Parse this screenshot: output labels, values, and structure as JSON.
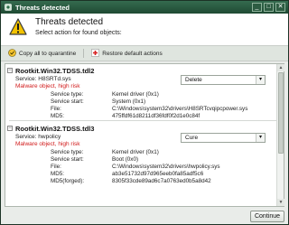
{
  "window": {
    "title": "Threats detected",
    "controls": [
      "_",
      "□",
      "✕"
    ]
  },
  "header": {
    "title": "Threats detected",
    "subtitle": "Select action for found objects:"
  },
  "toolbar": {
    "copy_label": "Copy all to quarantine",
    "restore_label": "Restore default actions"
  },
  "threats": [
    {
      "name": "Rootkit.Win32.TDSS.tdl2",
      "service": "Service: H8SRTd.sys",
      "risk": "Malware object, high risk",
      "action": "Delete",
      "details": [
        {
          "label": "Service type:",
          "value": "Kernel driver (0x1)"
        },
        {
          "label": "Service start:",
          "value": "System (0x1)"
        },
        {
          "label": "File:",
          "value": "C:\\Windows\\system32\\drivers\\H8SRTcvqipcpower.sys"
        },
        {
          "label": "MD5:",
          "value": "475ffdf61d8211df36fdf0f2d1e0c84f"
        }
      ]
    },
    {
      "name": "Rootkit.Win32.TDSS.tdl3",
      "service": "Service: hwpolicy",
      "risk": "Malware object, high risk",
      "action": "Cure",
      "details": [
        {
          "label": "Service type:",
          "value": "Kernel driver (0x1)"
        },
        {
          "label": "Service start:",
          "value": "Boot (0x0)"
        },
        {
          "label": "File:",
          "value": "C:\\Windows\\system32\\drivers\\hwpolicy.sys"
        },
        {
          "label": "MD5:",
          "value": "ab3e51732d97d965eeb0fa85adf5c6"
        },
        {
          "label": "MD5(forged):",
          "value": "8305f33cde89ad6c7a0763ed0b5a8d42"
        }
      ]
    }
  ],
  "footer": {
    "continue_label": "Continue"
  },
  "colors": {
    "titlebar": "#1f4a33",
    "risk_text": "#d11a1a",
    "warning_icon": "#f2c200"
  },
  "icons": [
    "warning-icon",
    "quarantine-icon",
    "restore-icon",
    "app-icon"
  ]
}
